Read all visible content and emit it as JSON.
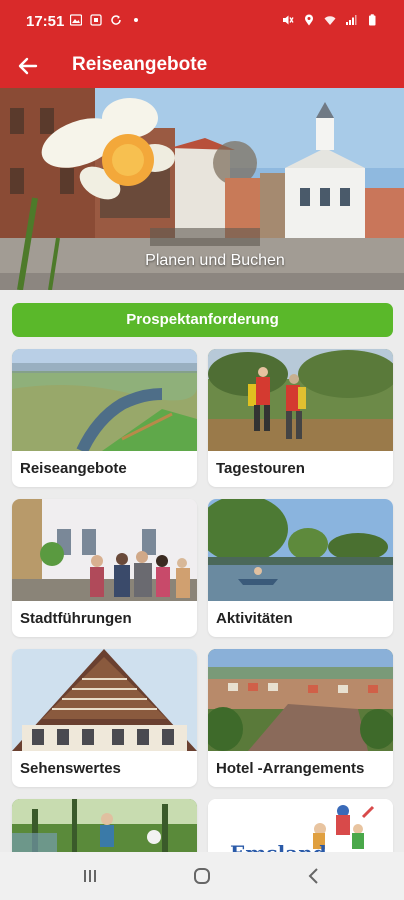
{
  "status_bar": {
    "time": "17:51"
  },
  "app_bar": {
    "title": "Reiseangebote"
  },
  "hero": {
    "caption": "Planen und  Buchen"
  },
  "prospekt_button": {
    "label": "Prospektanforderung"
  },
  "tiles": [
    {
      "label": "Reiseangebote"
    },
    {
      "label": "Tagestouren"
    },
    {
      "label": "Stadtführungen"
    },
    {
      "label": "Aktivitäten"
    },
    {
      "label": "Sehenswertes"
    },
    {
      "label": "Hotel -Arrangements"
    },
    {
      "label": ""
    },
    {
      "label": "Emsland"
    }
  ],
  "colors": {
    "brand_red": "#d92a2a",
    "action_green": "#5ab82a"
  }
}
